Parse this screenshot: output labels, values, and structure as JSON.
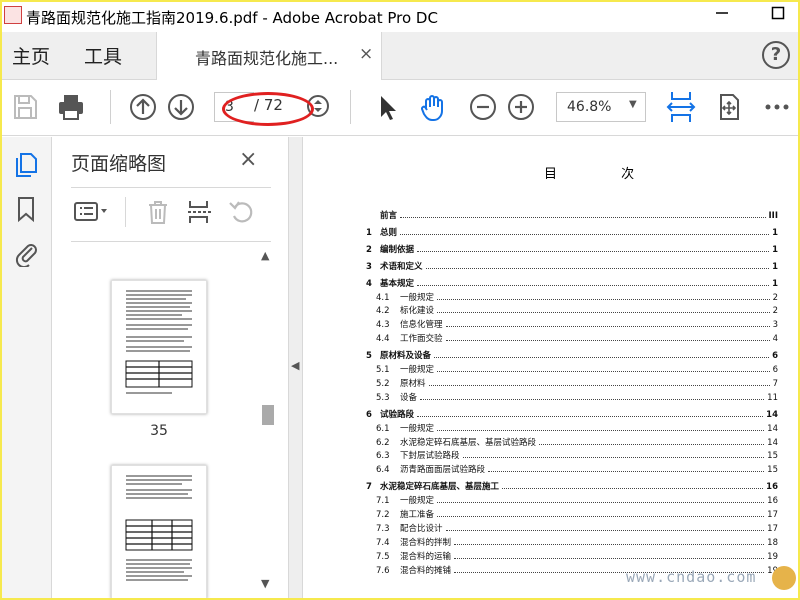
{
  "window": {
    "title": "青路面规范化施工指南2019.6.pdf - Adobe Acrobat Pro DC",
    "minimize_icon": "minimize-icon",
    "maximize_icon": "maximize-icon"
  },
  "tabs": {
    "home": "主页",
    "tools": "工具",
    "document": "青路面规范化施工...",
    "close_glyph": "×",
    "help_glyph": "?"
  },
  "toolbar": {
    "current_page": "3",
    "total_pages": "/ 72",
    "zoom": "46.8%"
  },
  "panel": {
    "title": "页面缩略图",
    "close_glyph": "×",
    "thumbnails": [
      {
        "label": "35"
      },
      {
        "label": ""
      }
    ]
  },
  "document": {
    "toc_title": "目  次",
    "toc": [
      {
        "num": "",
        "text": "前言",
        "page": "III",
        "chapter": true
      },
      {
        "num": "1",
        "text": "总则",
        "page": "1",
        "chapter": true
      },
      {
        "num": "2",
        "text": "编制依据",
        "page": "1",
        "chapter": true
      },
      {
        "num": "3",
        "text": "术语和定义",
        "page": "1",
        "chapter": true
      },
      {
        "num": "4",
        "text": "基本规定",
        "page": "1",
        "chapter": true
      },
      {
        "num": "4.1",
        "text": "一般规定",
        "page": "2",
        "chapter": false
      },
      {
        "num": "4.2",
        "text": "标化建设",
        "page": "2",
        "chapter": false
      },
      {
        "num": "4.3",
        "text": "信息化管理",
        "page": "3",
        "chapter": false
      },
      {
        "num": "4.4",
        "text": "工作面交验",
        "page": "4",
        "chapter": false
      },
      {
        "num": "5",
        "text": "原材料及设备",
        "page": "6",
        "chapter": true
      },
      {
        "num": "5.1",
        "text": "一般规定",
        "page": "6",
        "chapter": false
      },
      {
        "num": "5.2",
        "text": "原材料",
        "page": "7",
        "chapter": false
      },
      {
        "num": "5.3",
        "text": "设备",
        "page": "11",
        "chapter": false
      },
      {
        "num": "6",
        "text": "试验路段",
        "page": "14",
        "chapter": true
      },
      {
        "num": "6.1",
        "text": "一般规定",
        "page": "14",
        "chapter": false
      },
      {
        "num": "6.2",
        "text": "水泥稳定碎石底基层、基层试验路段",
        "page": "14",
        "chapter": false
      },
      {
        "num": "6.3",
        "text": "下封层试验路段",
        "page": "15",
        "chapter": false
      },
      {
        "num": "6.4",
        "text": "沥青路面面层试验路段",
        "page": "15",
        "chapter": false
      },
      {
        "num": "7",
        "text": "水泥稳定碎石底基层、基层施工",
        "page": "16",
        "chapter": true
      },
      {
        "num": "7.1",
        "text": "一般规定",
        "page": "16",
        "chapter": false
      },
      {
        "num": "7.2",
        "text": "施工准备",
        "page": "17",
        "chapter": false
      },
      {
        "num": "7.3",
        "text": "配合比设计",
        "page": "17",
        "chapter": false
      },
      {
        "num": "7.4",
        "text": "混合料的拌制",
        "page": "18",
        "chapter": false
      },
      {
        "num": "7.5",
        "text": "混合料的运输",
        "page": "19",
        "chapter": false
      },
      {
        "num": "7.6",
        "text": "混合料的摊铺",
        "page": "19",
        "chapter": false
      }
    ]
  },
  "watermark": "www.cndao.com",
  "colors": {
    "accent": "#1473e6",
    "annotation": "#e02020",
    "frame": "#f6e94e"
  }
}
